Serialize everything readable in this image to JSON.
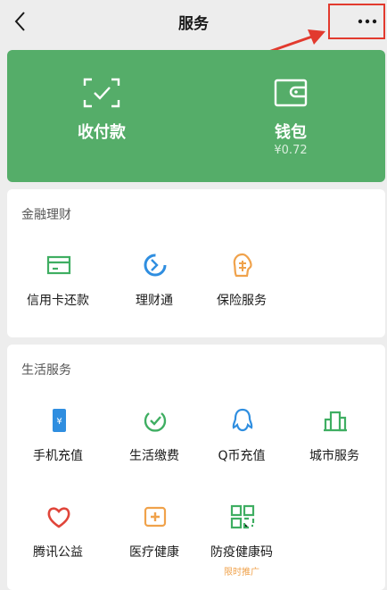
{
  "nav": {
    "title": "服务"
  },
  "hero": {
    "pay_label": "收付款",
    "wallet_label": "钱包",
    "wallet_balance": "¥0.72"
  },
  "finance": {
    "title": "金融理财",
    "items": [
      {
        "label": "信用卡还款",
        "icon": "credit-card-icon"
      },
      {
        "label": "理财通",
        "icon": "wealth-icon"
      },
      {
        "label": "保险服务",
        "icon": "insurance-icon"
      }
    ]
  },
  "life": {
    "title": "生活服务",
    "items": [
      {
        "label": "手机充值",
        "icon": "phone-topup-icon"
      },
      {
        "label": "生活缴费",
        "icon": "bill-pay-icon"
      },
      {
        "label": "Q币充值",
        "icon": "qq-coin-icon"
      },
      {
        "label": "城市服务",
        "icon": "city-service-icon"
      },
      {
        "label": "腾讯公益",
        "icon": "charity-icon"
      },
      {
        "label": "医疗健康",
        "icon": "medical-icon"
      },
      {
        "label": "防疫健康码",
        "icon": "health-code-icon",
        "tag": "限时推广"
      }
    ]
  },
  "colors": {
    "brand_green": "#55ad69",
    "icon_green": "#3fae62",
    "highlight_red": "#e23a2e",
    "promo_orange": "#f0a24b"
  }
}
